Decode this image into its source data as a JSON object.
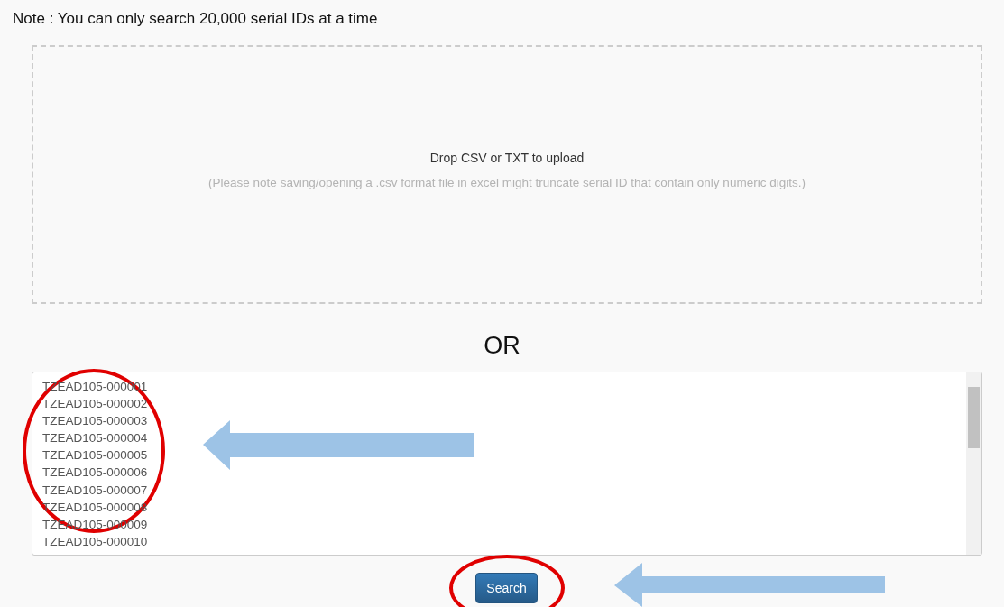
{
  "note": "Note : You can only search 20,000 serial IDs at a time",
  "drop_zone": {
    "title": "Drop CSV or TXT to upload",
    "hint": "(Please note saving/opening a .csv format file in excel might truncate serial ID that contain only numeric digits.)"
  },
  "separator": "OR",
  "serial_input": {
    "lines": [
      "TZEAD105-000001",
      "TZEAD105-000002",
      "TZEAD105-000003",
      "TZEAD105-000004",
      "TZEAD105-000005",
      "TZEAD105-000006",
      "TZEAD105-000007",
      "TZEAD105-000008",
      "TZEAD105-000009",
      "TZEAD105-000010"
    ]
  },
  "buttons": [
    {
      "label": "Search"
    }
  ]
}
